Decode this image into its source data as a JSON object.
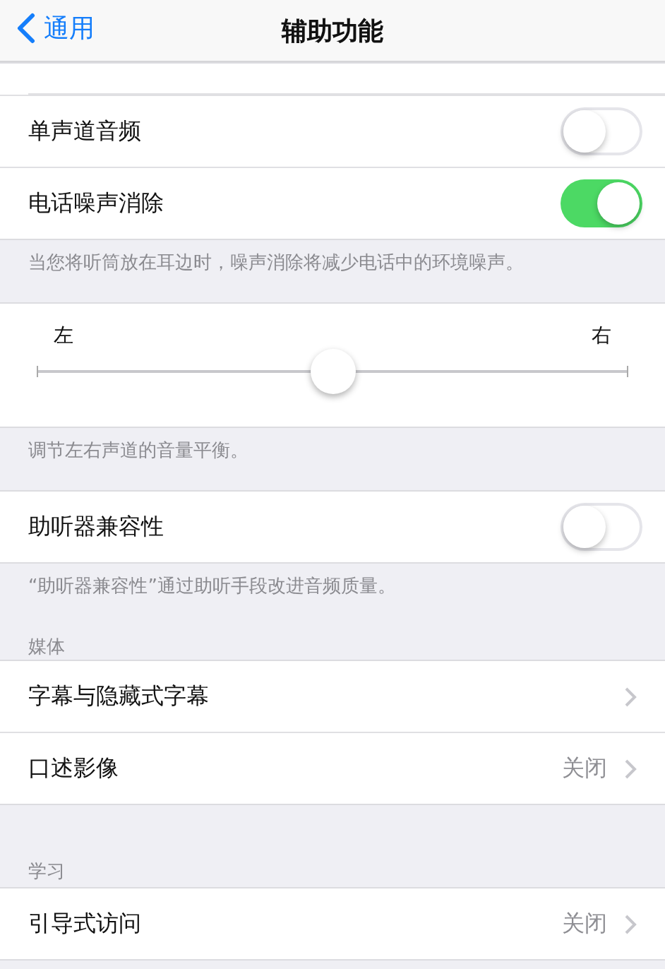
{
  "nav": {
    "back": "通用",
    "title": "辅助功能"
  },
  "sections": [
    {
      "rows": [
        {
          "kind": "toggle",
          "label": "单声道音频",
          "on": false
        },
        {
          "kind": "toggle",
          "label": "电话噪声消除",
          "on": true
        }
      ],
      "footer": "当您将听筒放在耳边时，噪声消除将减少电话中的环境噪声。"
    },
    {
      "slider": {
        "left_label": "左",
        "right_label": "右",
        "level": 0.5
      },
      "footer": "调节左右声道的音量平衡。"
    },
    {
      "rows": [
        {
          "kind": "toggle",
          "label": "助听器兼容性",
          "on": false
        }
      ],
      "footer": "“助听器兼容性”通过助听手段改进音频质量。"
    },
    {
      "header": "媒体",
      "rows": [
        {
          "kind": "link",
          "label": "字幕与隐藏式字幕"
        },
        {
          "kind": "link",
          "label": "口述影像",
          "value": "关闭"
        }
      ]
    },
    {
      "header": "学习",
      "rows": [
        {
          "kind": "link",
          "label": "引导式访问",
          "value": "关闭"
        }
      ]
    }
  ]
}
